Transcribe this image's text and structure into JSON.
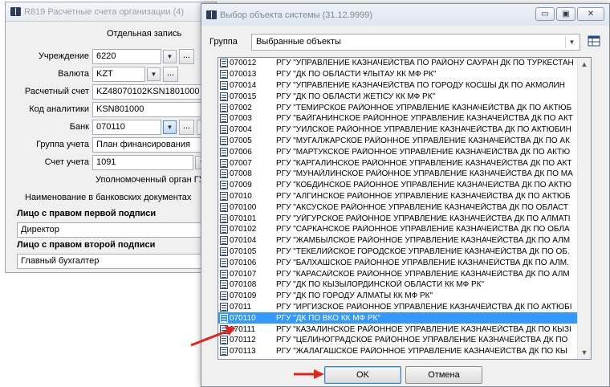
{
  "background_window": {
    "title": "R819 Расчетные счета организации (4)",
    "subtitle": "Отдельная запись",
    "fields": [
      {
        "label": "Учреждение",
        "value": "6220"
      },
      {
        "label": "Валюта",
        "value": "KZT"
      },
      {
        "label": "Расчетный счет",
        "value": "KZ48070102KSN1801000"
      },
      {
        "label": "Код аналитики",
        "value": "KSN801000"
      },
      {
        "label": "Банк",
        "value": "070110"
      },
      {
        "label": "Группа учета",
        "value": "План финансирования"
      },
      {
        "label": "Счет учета",
        "value": "1091"
      }
    ],
    "truncated_k": "К",
    "truncated_p": "Р",
    "authorized_label": "Уполномоченный орган ГУ",
    "bank_docs_label": "Наименование в банковских документах",
    "first_signature_header": "Лицо с правом первой подписи",
    "first_signature_value": "Директор",
    "second_signature_header": "Лицо с правом второй подписи",
    "second_signature_value": "Главный бухгалтер",
    "dots": "..."
  },
  "dialog": {
    "title": "Выбор объекта системы (31.12.9999)",
    "group_label": "Группа",
    "group_value": "Выбранные объекты",
    "items": [
      {
        "code": "070012",
        "name": "РГУ \"УПРАВЛЕНИЕ КАЗНАЧЕЙСТВА ПО РАЙОНУ САУРАН ДК ПО ТУРКЕСТАН"
      },
      {
        "code": "070013",
        "name": "РГУ \"ДК ПО ОБЛАСТИ ҰЛЫТАУ КК МФ РК\""
      },
      {
        "code": "070014",
        "name": "РГУ \"УПРАВЛЕНИЕ КАЗНАЧЕЙСТВА ПО ГОРОДУ КОСШЫ ДК ПО АКМОЛИН"
      },
      {
        "code": "070015",
        "name": "РГУ \"ДК ПО ОБЛАСТИ ЖЕТІСУ КК МФ РК\""
      },
      {
        "code": "07002",
        "name": "РГУ \"ТЕМИРСКОЕ РАЙОННОЕ УПРАВЛЕНИЕ КАЗНАЧЕЙСТВА ДК ПО АКТЮБ"
      },
      {
        "code": "07003",
        "name": "РГУ \"БАЙГАНИНСКОЕ РАЙОННОЕ УПРАВЛЕНИЕ КАЗНАЧЕЙСТВА ДК ПО АКТ"
      },
      {
        "code": "07004",
        "name": "РГУ \"УИЛСКОЕ РАЙОННОЕ УПРАВЛЕНИЕ КАЗНАЧЕЙСТВА ДК ПО АКТЮБИН"
      },
      {
        "code": "07005",
        "name": "РГУ \"МУГАЛЖАРСКОЕ РАЙОННОЕ УПРАВЛЕНИЕ КАЗНАЧЕЙСТВА ДК ПО АК"
      },
      {
        "code": "07006",
        "name": "РГУ \"МАРТУКСКОЕ РАЙОННОЕ УПРАВЛЕНИЕ КАЗНАЧЕЙСТВА ДК ПО АКТЮ"
      },
      {
        "code": "07007",
        "name": "РГУ \"КАРГАЛИНСКОЕ РАЙОННОЕ УПРАВЛЕНИЕ КАЗНАЧЕЙСТВА ДК ПО АКТ"
      },
      {
        "code": "07008",
        "name": "РГУ \"МУНАЙЛИНСКОЕ РАЙОННОЕ УПРАВЛЕНИЕ КАЗНАЧЕЙСТВА ДК ПО МА"
      },
      {
        "code": "07009",
        "name": "РГУ \"КОБДИНСКОЕ РАЙОННОЕ УПРАВЛЕНИЕ КАЗНАЧЕЙСТВА ДК ПО АКТЮ"
      },
      {
        "code": "07010",
        "name": "РГУ \"АЛГИНСКОЕ РАЙОННОЕ УПРАВЛЕНИЕ КАЗНАЧЕЙСТВА ДК ПО АКТЮБ"
      },
      {
        "code": "070100",
        "name": "РГУ \"АКСУСКОЕ РАЙОННОЕ УПРАВЛЕНИЕ КАЗНАЧЕЙСТВА ДК ПО ОБЛАСТ"
      },
      {
        "code": "070101",
        "name": "РГУ \"УЙГУРСКОЕ РАЙОННОЕ УПРАВЛЕНИЕ КАЗНАЧЕЙСТВА ДК ПО АЛМАТІ"
      },
      {
        "code": "070102",
        "name": "РГУ \"САРКАНСКОЕ РАЙОННОЕ УПРАВЛЕНИЕ КАЗНАЧЕЙСТВА ДК ПО ОБЛА"
      },
      {
        "code": "070104",
        "name": "РГУ \"ЖАМБЫЛСКОЕ РАЙОННОЕ УПРАВЛЕНИЕ КАЗНАЧЕЙСТВА ДК ПО АЛМ"
      },
      {
        "code": "070105",
        "name": "РГУ \"ТЕКЕЛИЙСКОЕ ГОРОДСКОЕ УПРАВЛЕНИЕ КАЗНАЧЕЙСТВА ДК ПО ОБ."
      },
      {
        "code": "070106",
        "name": "РГУ \"БАЛХАШСКОЕ РАЙОННОЕ УПРАВЛЕНИЕ КАЗНАЧЕЙСТВА ДК ПО АЛМ."
      },
      {
        "code": "070107",
        "name": "РГУ \"КАРАСАЙСКОЕ РАЙОННОЕ УПРАВЛЕНИЕ КАЗНАЧЕЙСТВА ДК ПО АЛМ"
      },
      {
        "code": "070108",
        "name": "РГУ \"ДК ПО КЫЗЫЛОРДИНСКОЙ ОБЛАСТИ КК МФ РК\""
      },
      {
        "code": "070109",
        "name": "РГУ \"ДК ПО ГОРОДУ АЛМАТЫ КК МФ РК\""
      },
      {
        "code": "07011",
        "name": "РГУ \"ИРГИЗСКОЕ РАЙОННОЕ УПРАВЛЕНИЕ КАЗНАЧЕЙСТВА ДК ПО АКТЮБІ"
      },
      {
        "code": "070110",
        "name": "РГУ \"ДК ПО ВКО КК МФ РК\"",
        "selected": true
      },
      {
        "code": "070111",
        "name": "РГУ \"КАЗАЛИНСКОЕ РАЙОННОЕ УПРАВЛЕНИЕ КАЗНАЧЕЙСТВА ДК ПО КЫЗІ"
      },
      {
        "code": "070112",
        "name": "РГУ \"ЦЕЛИНОГРАДСКОЕ РАЙОННОЕ УПРАВЛЕНИЕ КАЗНАЧЕЙСТВА ДК ПО"
      },
      {
        "code": "070113",
        "name": "РГУ \"ЖАЛАГАШСКОЕ РАЙОННОЕ УПРАВЛЕНИЕ КАЗНАЧЕЙСТВА ДК ПО КЫ"
      }
    ],
    "ok_label": "OK",
    "cancel_label": "Отмена"
  },
  "colors": {
    "selection": "#3399ff",
    "annotation_arrow": "#e0251b"
  }
}
